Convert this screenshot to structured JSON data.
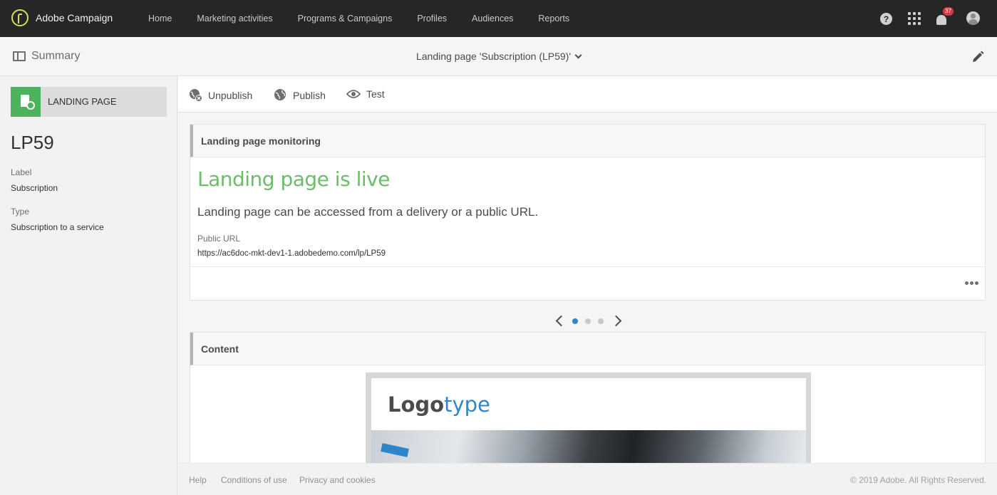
{
  "app": {
    "brand": "Adobe Campaign"
  },
  "nav": {
    "items": [
      "Home",
      "Marketing activities",
      "Programs & Campaigns",
      "Profiles",
      "Audiences",
      "Reports"
    ],
    "notifications_count": "37",
    "help_glyph": "?"
  },
  "header": {
    "summary_label": "Summary",
    "page_title": "Landing page 'Subscription (LP59)'"
  },
  "sidebar": {
    "type_label": "LANDING PAGE",
    "code": "LP59",
    "label_title": "Label",
    "label_value": "Subscription",
    "type_title": "Type",
    "type_value": "Subscription to a service"
  },
  "toolbar": {
    "unpublish": "Unpublish",
    "publish": "Publish",
    "test": "Test"
  },
  "monitoring": {
    "title": "Landing page monitoring",
    "status": "Landing page is live",
    "description": "Landing page can be accessed from a delivery or a public URL.",
    "url_label": "Public URL",
    "url_value": "https://ac6doc-mkt-dev1-1.adobedemo.com/lp/LP59"
  },
  "pager": {
    "pages": 3,
    "active": 1
  },
  "content": {
    "title": "Content",
    "logo_part1": "Logo",
    "logo_part2": "type"
  },
  "footer": {
    "help": "Help",
    "conditions": "Conditions of use",
    "privacy": "Privacy and cookies",
    "copyright": "© 2019 Adobe. All Rights Reserved."
  },
  "colors": {
    "topbar": "#262626",
    "accent_green": "#4db25e",
    "live_green": "#6cbc6c",
    "active_dot": "#2e86c9",
    "badge": "#d7373f"
  }
}
